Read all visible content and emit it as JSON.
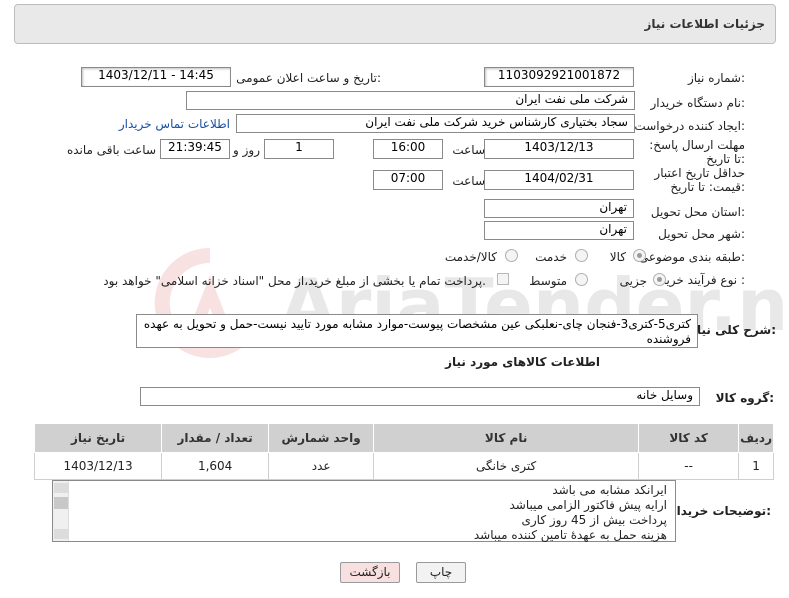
{
  "header": {
    "title": "جزئیات اطلاعات نیاز"
  },
  "form": {
    "need_number_label": "شماره نیاز:",
    "need_number": "1103092921001872",
    "announce_label": "تاریخ و ساعت اعلان عمومی:",
    "announce_value": "1403/12/11 - 14:45",
    "buyer_org_label": "نام دستگاه خریدار:",
    "buyer_org": "شرکت ملی نفت ایران",
    "creator_label": "ایجاد کننده درخواست:",
    "creator": "سجاد بختیاری کارشناس خرید شرکت ملی نفت ایران",
    "contact_link": "اطلاعات تماس خریدار",
    "deadline_label": "مهلت ارسال پاسخ: تا تاریخ:",
    "deadline_date": "1403/12/13",
    "hour_label": "ساعت",
    "deadline_time": "16:00",
    "days_value": "1",
    "days_label": "روز و",
    "remaining_time": "21:39:45",
    "remaining_label": "ساعت باقی مانده",
    "validity_label": "حداقل تاریخ اعتبار قیمت: تا تاریخ:",
    "validity_date": "1404/02/31",
    "validity_time": "07:00",
    "province_label": "استان محل تحویل:",
    "province": "تهران",
    "city_label": "شهر محل تحویل:",
    "city": "تهران",
    "category_label": "طبقه بندی موضوعی:",
    "category_options": [
      "کالا",
      "خدمت",
      "کالا/خدمت"
    ],
    "category_selected": "کالا",
    "purchase_type_label": "نوع فرآیند خرید :",
    "purchase_options": [
      "جزیی",
      "متوسط"
    ],
    "purchase_selected": "جزیی",
    "payment_note": "پرداخت تمام یا بخشی از مبلغ خرید،از محل \"اسناد خزانه اسلامی\" خواهد بود.",
    "summary_label": "شرح کلی نیاز:",
    "summary": "کتری5-کتری3-فنجان چای-نعلبکی عین مشخصات پیوست-موارد مشابه مورد تایید نیست-حمل و تحویل به عهده فروشنده",
    "goods_info_title": "اطلاعات کالاهای مورد نیاز",
    "goods_group_label": "گروه کالا:",
    "goods_group": "وسایل خانه"
  },
  "table": {
    "headers": [
      "ردیف",
      "کد کالا",
      "نام کالا",
      "واحد شمارش",
      "تعداد / مقدار",
      "تاریخ نیاز"
    ],
    "rows": [
      [
        "1",
        "--",
        "کتری خانگی",
        "عدد",
        "1,604",
        "1403/12/13"
      ]
    ]
  },
  "notes": {
    "label": "توضیحات خریدار:",
    "lines": [
      "ایرانکد مشابه می باشد",
      "ارایه پیش فاکتور الزامی میباشد",
      "پرداخت بیش از 45 روز کاری",
      "هزینه حمل به عهدهٔ تامین کننده میباشد"
    ]
  },
  "buttons": {
    "print": "چاپ",
    "back": "بازگشت"
  },
  "watermark": "AriaTender.neT",
  "colors": {
    "link": "#1a4fa3",
    "back_button_bg": "#f8e0e0",
    "header_bg": "#e9e9e9"
  }
}
